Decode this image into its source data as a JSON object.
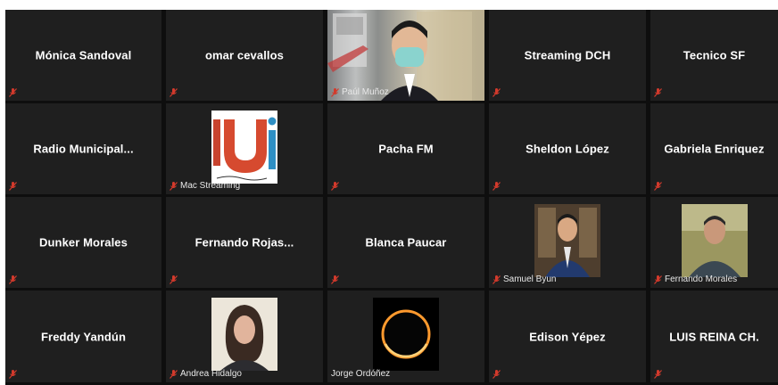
{
  "colors": {
    "tile_bg": "#1f1f1f",
    "gap_bg": "#0e0e0e",
    "muted_icon": "#d33a2c",
    "name_text": "#ffffff"
  },
  "participants": [
    {
      "name": "Mónica Sandoval",
      "kind": "name",
      "muted": true
    },
    {
      "name": "omar cevallos",
      "kind": "name",
      "muted": true
    },
    {
      "name": "Paúl Muñoz",
      "kind": "video",
      "muted": true
    },
    {
      "name": "Streaming DCH",
      "kind": "name",
      "muted": true
    },
    {
      "name": "Tecnico SF",
      "kind": "name",
      "muted": true
    },
    {
      "name": "Radio  Municipal...",
      "kind": "name",
      "muted": true
    },
    {
      "name": "Mac Streaming",
      "kind": "logo",
      "logo_text": "Ui",
      "muted": true
    },
    {
      "name": "Pacha FM",
      "kind": "name",
      "muted": true
    },
    {
      "name": "Sheldon López",
      "kind": "name",
      "muted": true
    },
    {
      "name": "Gabriela Enriquez",
      "kind": "name",
      "muted": true
    },
    {
      "name": "Dunker Morales",
      "kind": "name",
      "muted": true
    },
    {
      "name": "Fernando  Rojas...",
      "kind": "name",
      "muted": true
    },
    {
      "name": "Blanca Paucar",
      "kind": "name",
      "muted": true
    },
    {
      "name": "Samuel Byun",
      "kind": "photo",
      "photo": "samuel",
      "muted": true
    },
    {
      "name": "Fernando Morales",
      "kind": "photo",
      "photo": "fernando",
      "muted": true
    },
    {
      "name": "Freddy Yandún",
      "kind": "name",
      "muted": true
    },
    {
      "name": "Andrea Hidalgo",
      "kind": "photo",
      "photo": "andrea",
      "muted": true
    },
    {
      "name": "Jorge Ordóñez",
      "kind": "photo",
      "photo": "eclipse",
      "muted": true
    },
    {
      "name": "Edison Yépez",
      "kind": "name",
      "muted": true
    },
    {
      "name": "LUIS REINA CH.",
      "kind": "name",
      "muted": true
    }
  ]
}
